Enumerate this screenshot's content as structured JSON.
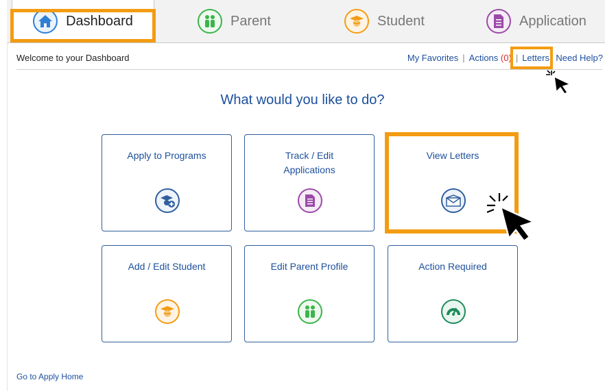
{
  "tabs": [
    {
      "label": "Dashboard",
      "icon": "home-icon",
      "color": "#2f7fd6",
      "active": true
    },
    {
      "label": "Parent",
      "icon": "parent-icon",
      "color": "#3bb54a",
      "active": false
    },
    {
      "label": "Student",
      "icon": "student-icon",
      "color": "#f39c12",
      "active": false
    },
    {
      "label": "Application",
      "icon": "application-icon",
      "color": "#9b4aa8",
      "active": false
    }
  ],
  "header": {
    "welcome": "Welcome to your Dashboard",
    "links": {
      "favorites": "My Favorites",
      "actions": "Actions",
      "actions_count": "(0)",
      "letters": "Letters",
      "help": "Need Help?"
    }
  },
  "main": {
    "heading": "What would you like to do?",
    "cards": [
      {
        "title_line1": "Apply to Programs",
        "title_line2": "",
        "icon": "apply-programs-icon",
        "color": "#2f5f9e"
      },
      {
        "title_line1": "Track / Edit",
        "title_line2": "Applications",
        "icon": "document-icon",
        "color": "#9b4aa8"
      },
      {
        "title_line1": "View Letters",
        "title_line2": "",
        "icon": "envelope-icon",
        "color": "#2f5f9e"
      },
      {
        "title_line1": "Add / Edit Student",
        "title_line2": "",
        "icon": "student-icon",
        "color": "#f39c12"
      },
      {
        "title_line1": "Edit Parent Profile",
        "title_line2": "",
        "icon": "parent-icon",
        "color": "#3bb54a"
      },
      {
        "title_line1": "Action Required",
        "title_line2": "",
        "icon": "gauge-icon",
        "color": "#1f8a5a"
      }
    ]
  },
  "footer": {
    "home_link": "Go to Apply Home"
  },
  "highlight_color": "#f39c12"
}
